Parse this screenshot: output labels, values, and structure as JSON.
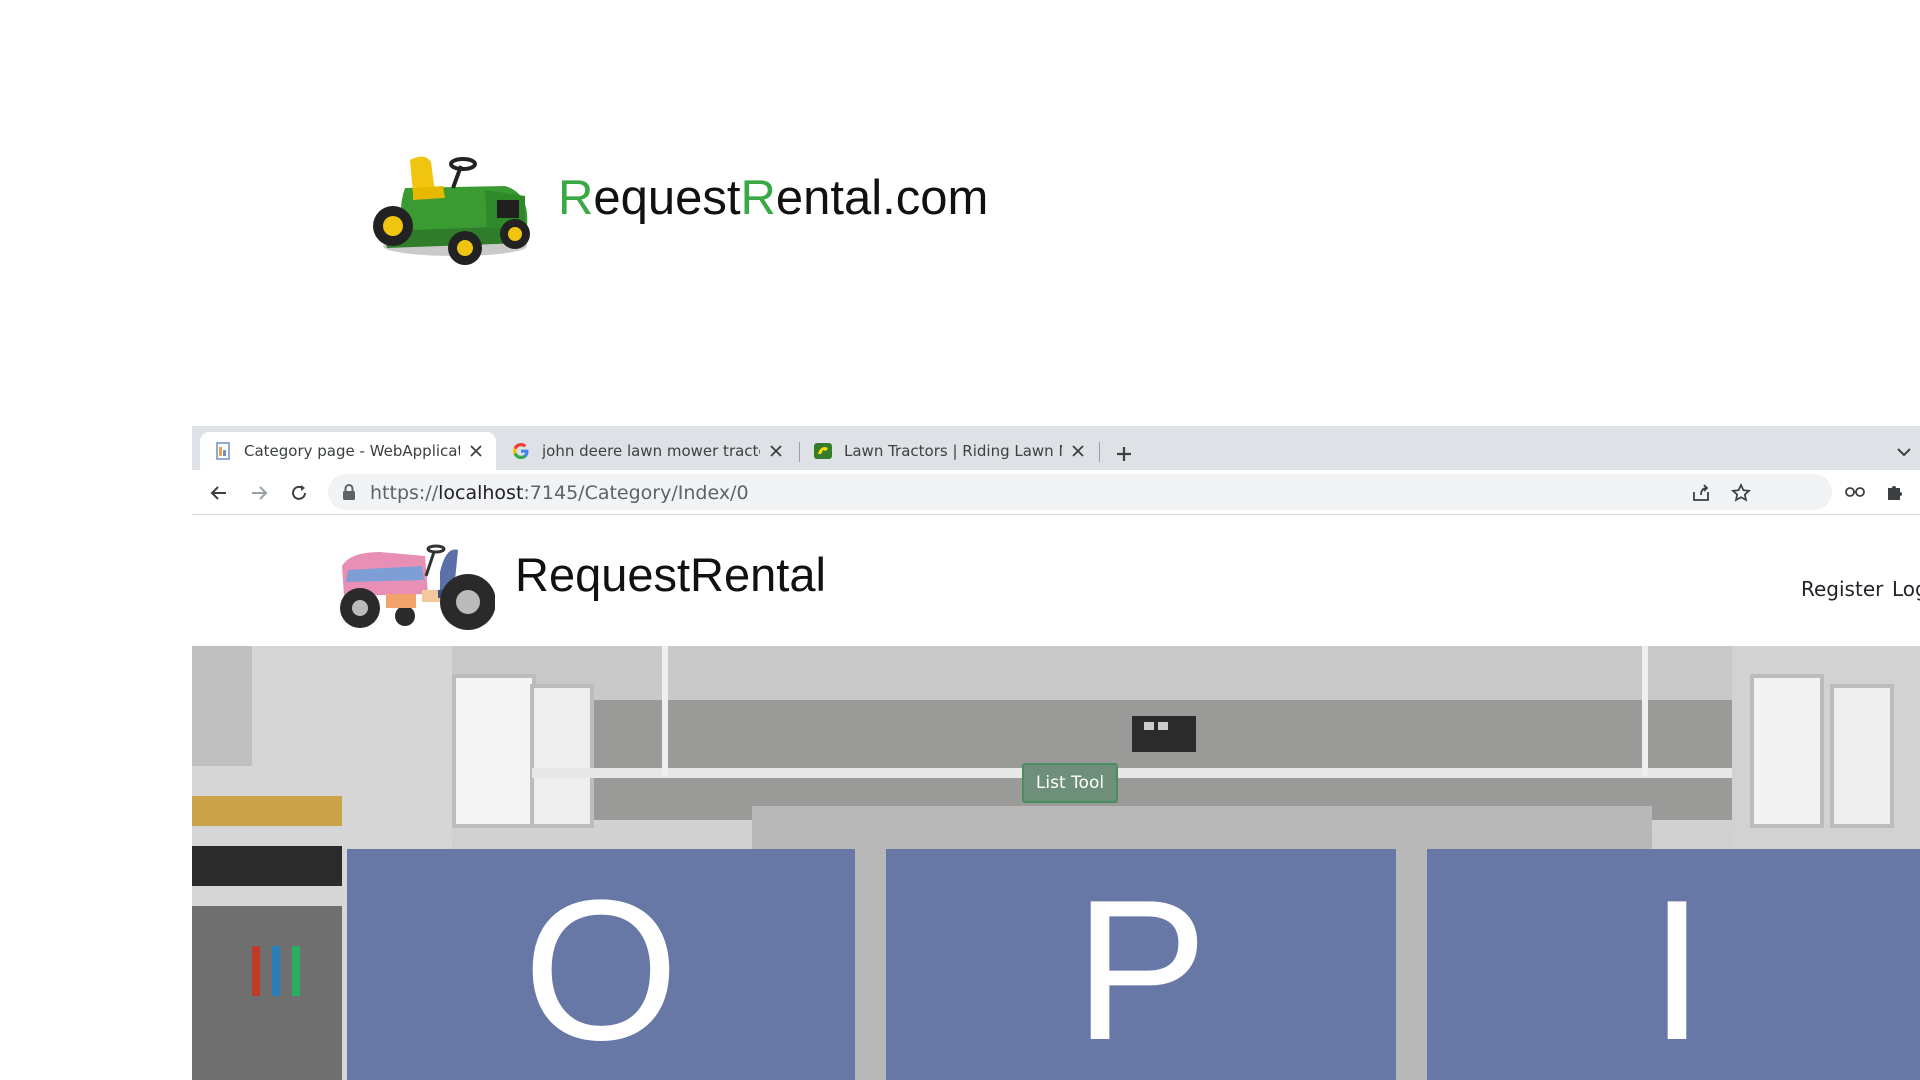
{
  "top_logo": {
    "brand_part1": "R",
    "brand_part2": "equest",
    "brand_part3": "R",
    "brand_part4": "ental.com",
    "accent_color": "#3aa845"
  },
  "browser": {
    "tabs": [
      {
        "title": "Category page - WebApplication",
        "favicon": "document-icon",
        "active": true
      },
      {
        "title": "john deere lawn mower tractor -",
        "favicon": "google-icon",
        "active": false
      },
      {
        "title": "Lawn Tractors | Riding Lawn Mow",
        "favicon": "john-deere-icon",
        "active": false
      }
    ],
    "url_scheme": "https://",
    "url_host": "localhost",
    "url_rest": ":7145/Category/Index/0"
  },
  "site": {
    "name": "RequestRental",
    "nav": {
      "register": "Register",
      "login": "Log"
    }
  },
  "hero": {
    "button_label": "List Tool",
    "tiles": [
      "O",
      "P",
      "I"
    ],
    "tile_color": "#6878a6"
  }
}
